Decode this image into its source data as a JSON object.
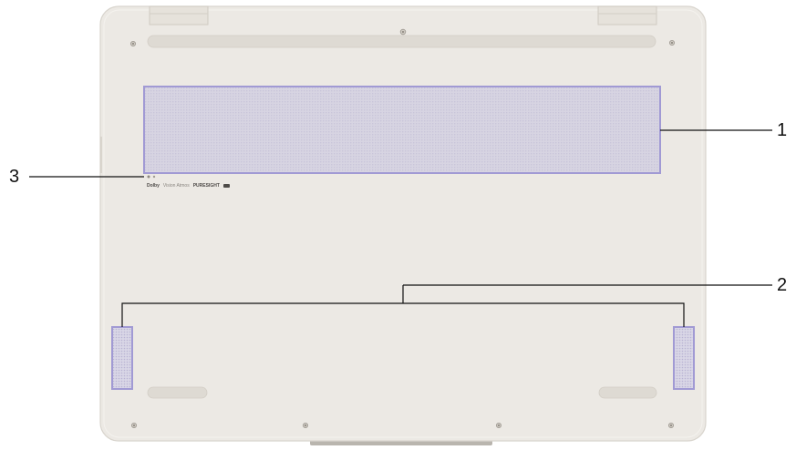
{
  "callouts": [
    {
      "number": "1",
      "part": "cover-vent"
    },
    {
      "number": "2",
      "part": "speakers"
    },
    {
      "number": "3",
      "part": "reset-hole"
    }
  ],
  "logos": {
    "dolby": "Dolby",
    "atmos": "Vision Atmos",
    "puresight": "PURESIGHT"
  },
  "colors": {
    "chassis": "#ece9e4",
    "chassis_edge": "#d8d4cd",
    "highlight_fill": "#d9d6e3",
    "highlight_stroke": "#a19ad4",
    "leader_line": "#111111",
    "foot": "#dedad3"
  }
}
